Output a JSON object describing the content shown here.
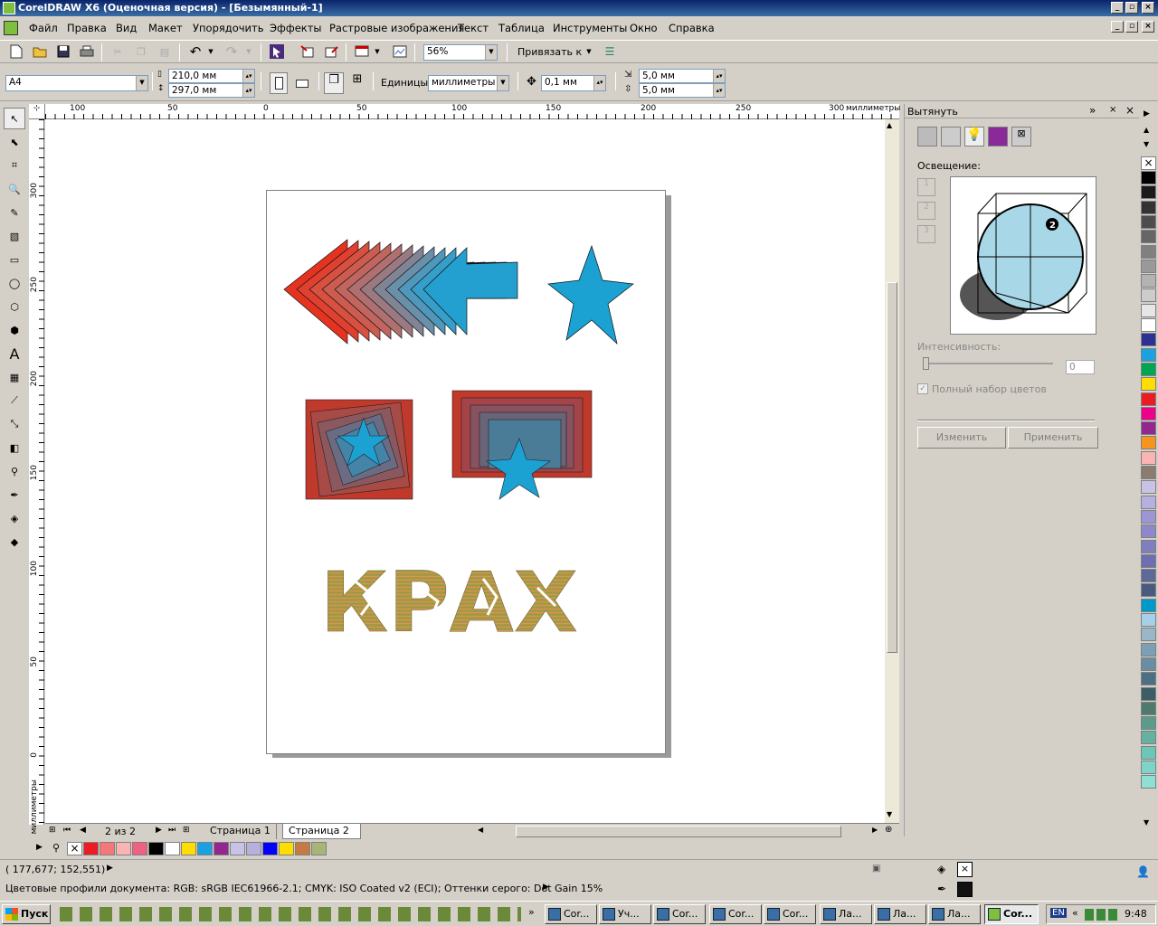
{
  "window": {
    "title": "CorelDRAW X6 (Оценочная версия) - [Безымянный-1]"
  },
  "menu": [
    "Файл",
    "Правка",
    "Вид",
    "Макет",
    "Упорядочить",
    "Эффекты",
    "Растровые изображения",
    "Текст",
    "Таблица",
    "Инструменты",
    "Окно",
    "Справка"
  ],
  "toolbar": {
    "zoom": "56%",
    "snap_label": "Привязать к"
  },
  "property_bar": {
    "page_size": "A4",
    "width": "210,0 мм",
    "height": "297,0 мм",
    "units_label": "Единицы:",
    "units_value": "миллиметры",
    "nudge": "0,1 мм",
    "dup_x": "5,0 мм",
    "dup_y": "5,0 мм"
  },
  "ruler": {
    "h_labels": [
      "100",
      "50",
      "0",
      "50",
      "100",
      "150",
      "200",
      "250",
      "300"
    ],
    "h_unit": "миллиметры",
    "v_labels": [
      "300",
      "250",
      "200",
      "150",
      "100",
      "50",
      "0"
    ],
    "v_unit": "миллиметры"
  },
  "canvas": {
    "text_art": "КРАХ"
  },
  "pages": {
    "counter": "2 из 2",
    "tabs": [
      "Страница 1",
      "Страница 2"
    ],
    "active": 1
  },
  "docker": {
    "title": "Вытянуть",
    "lighting_label": "Освещение:",
    "light_buttons": [
      "1",
      "2",
      "3"
    ],
    "marker": "2",
    "intensity_label": "Интенсивность:",
    "intensity_value": "0",
    "checkbox_label": "Полный набор цветов",
    "btn_edit": "Изменить",
    "btn_apply": "Применить"
  },
  "palette_colors": [
    "#000000",
    "#1a1a1a",
    "#333333",
    "#4d4d4d",
    "#666666",
    "#808080",
    "#999999",
    "#b3b3b3",
    "#cccccc",
    "#e6e6e6",
    "#ffffff",
    "#2e3192",
    "#1ba1e2",
    "#00a651",
    "#ffdd00",
    "#ed1c24",
    "#ec008c",
    "#92278f",
    "#f7941d",
    "#fbb4b4",
    "#8c7b70",
    "#c8c2e6",
    "#b6b0de",
    "#9e96d4",
    "#8f86cc",
    "#7f7fbf",
    "#6e6eb3",
    "#5d6a99",
    "#4a5a7f",
    "#0099cc",
    "#a6cfe8",
    "#9ab7c9",
    "#7d9fb5",
    "#6b8da3",
    "#4d6f85",
    "#3d5c66",
    "#4d7a6b",
    "#5b9b8a",
    "#65b0a0",
    "#6dc7b8",
    "#7fd4c8",
    "#8fe0d4"
  ],
  "h_palette": [
    "#ed1c24",
    "#f4777a",
    "#fbb4b4",
    "#f06080",
    "#000000",
    "#ffffff",
    "#ffdd00",
    "#1ba1e2",
    "#92278f",
    "#c8c2e6",
    "#b6b0de",
    "#0000ff",
    "#ffdd00",
    "#c87941",
    "#a9b478"
  ],
  "status": {
    "coords": "( 177,677; 152,551)",
    "profile": "Цветовые профили документа: RGB: sRGB IEC61966-2.1; CMYK: ISO Coated v2 (ECI); Оттенки серого: Dot Gain 15%"
  },
  "taskbar": {
    "start": "Пуск",
    "tasks": [
      "Cor...",
      "Уч...",
      "Cor...",
      "Cor...",
      "Cor...",
      "Ла...",
      "Ла...",
      "Ла...",
      "Ла...",
      "Cor..."
    ],
    "lang": "EN",
    "clock": "9:48"
  },
  "colors": {
    "title_start": "#0a246a",
    "title_end": "#3a6ea5",
    "red": "#e63320",
    "cyan": "#1ba1d2"
  }
}
